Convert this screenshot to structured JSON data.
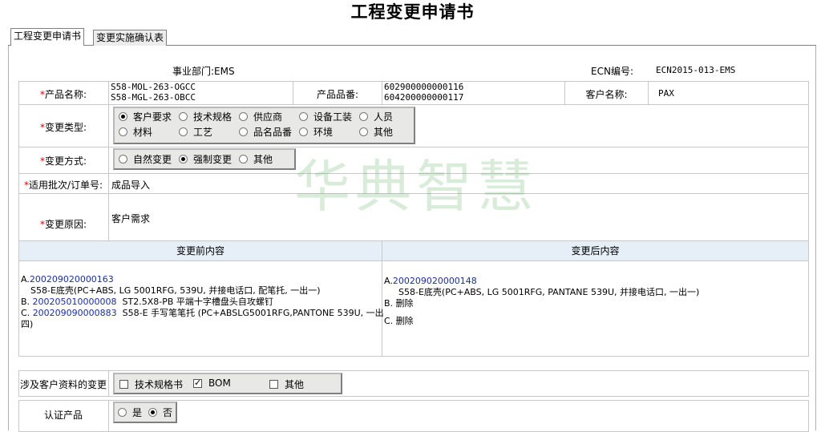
{
  "page_title": "工程变更申请书",
  "tabs": [
    "工程变更申请书",
    "变更实施确认表"
  ],
  "dept": "事业部门:EMS",
  "ecn_label": "ECN编号:",
  "ecn_value": "ECN2015-013-EMS",
  "product_name_label": "产品名称:",
  "product_names": [
    "S58-MOL-263-OGCC",
    "S58-MGL-263-OBCC"
  ],
  "product_no_label": "产品品番:",
  "product_nos": [
    "602900000000116",
    "604200000000117"
  ],
  "customer_label": "客户名称:",
  "customer_value": "PAX",
  "change_type_label": "变更类型:",
  "change_types": [
    "客户要求",
    "技术规格",
    "供应商",
    "设备工装",
    "人员",
    "材料",
    "工艺",
    "品名品番",
    "环境",
    "其他"
  ],
  "change_type_selected": "客户要求",
  "change_method_label": "变更方式:",
  "change_methods": [
    "自然变更",
    "强制变更",
    "其他"
  ],
  "change_method_selected": "强制变更",
  "batch_label": "适用批次/订单号:",
  "batch_value": "成品导入",
  "reason_label": "变更原因:",
  "reason_value": "客户需求",
  "before_header": "变更前内容",
  "after_header": "变更后内容",
  "before": {
    "a_prefix": "A.",
    "a_code": "200209020000163",
    "a_desc": "S58-E底壳(PC+ABS, LG 5001RFG, 539U, 并接电话口, 配笔托, 一出一)",
    "b_prefix": "B. ",
    "b_code": "200205010000008",
    "b_desc": "ST2.5X8-PB 平端十字槽盘头自攻螺钉",
    "c_prefix": "C. ",
    "c_code": "200209090000883",
    "c_desc": "S58-E 手写笔笔托   (PC+ABSLG5001RFG,PANTONE 539U, 一出",
    "c_desc2": "四)"
  },
  "after": {
    "a_prefix": "A.",
    "a_code": "200209020000148",
    "a_desc": "S58-E底壳(PC+ABS, LG 5001RFG, PANTANE 539U, 并接电话口, 一出一)",
    "b_line": "B. 删除",
    "c_line": "C. 删除"
  },
  "customer_doc_label": "涉及客户资料的变更",
  "customer_doc_options": [
    {
      "label": "技术规格书",
      "checked": false
    },
    {
      "label": "BOM",
      "checked": true
    },
    {
      "label": "其他",
      "checked": false
    }
  ],
  "cert_label": "认证产品",
  "cert_options": [
    "是",
    "否"
  ],
  "cert_selected": "否",
  "watermark": "华典智慧",
  "required_mark": "*"
}
